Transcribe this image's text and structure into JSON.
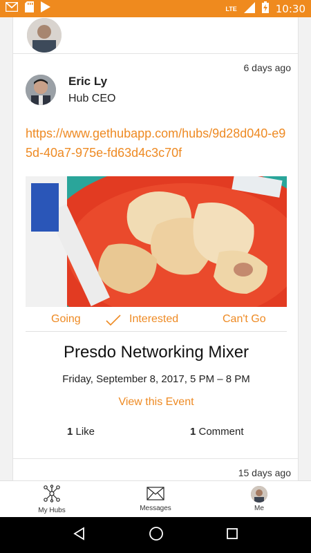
{
  "status_bar": {
    "network": "LTE",
    "time": "10:30"
  },
  "post": {
    "time_ago": "6 days ago",
    "author_name": "Eric Ly",
    "author_role": "Hub CEO",
    "link": "https://www.gethubapp.com/hubs/9d28d040-e95d-40a7-975e-fd63d4c3c70f",
    "rsvp": {
      "going": "Going",
      "interested": "Interested",
      "cant_go": "Can't Go"
    },
    "event_title": "Presdo Networking Mixer",
    "event_date": "Friday, September 8, 2017, 5 PM – 8 PM",
    "view_event": "View this Event",
    "like_count": "1",
    "like_label": " Like",
    "comment_count": "1",
    "comment_label": " Comment"
  },
  "next_post": {
    "time_ago": "15 days ago"
  },
  "bottom_nav": {
    "hubs": "My Hubs",
    "messages": "Messages",
    "me": "Me"
  },
  "colors": {
    "accent": "#ee8a23",
    "status_bar": "#ef8a1e"
  }
}
